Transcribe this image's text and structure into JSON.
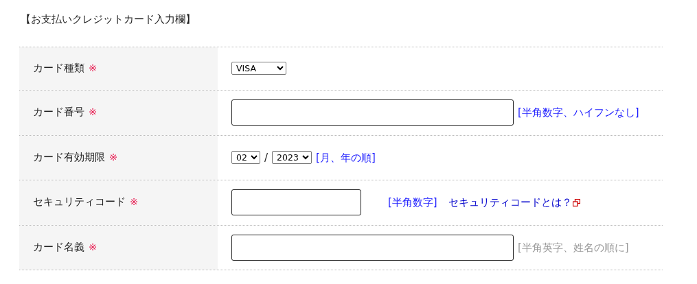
{
  "title": "【お支払いクレジットカード入力欄】",
  "rows": [
    {
      "label": "カード種類",
      "required": true,
      "mark": "※",
      "controls": [
        {
          "kind": "select-wide",
          "value": "VISA"
        }
      ]
    },
    {
      "label": "カード番号",
      "required": true,
      "mark": "※",
      "controls": [
        {
          "kind": "input-long"
        },
        {
          "kind": "hint",
          "text": "[半角数字、ハイフンなし]"
        }
      ]
    },
    {
      "label": "カード有効期限",
      "required": true,
      "mark": "※",
      "controls": [
        {
          "kind": "select",
          "value": "02"
        },
        {
          "kind": "separator",
          "text": "/"
        },
        {
          "kind": "select",
          "value": "2023"
        },
        {
          "kind": "hint",
          "text": "[月、年の順]"
        }
      ]
    },
    {
      "label": "セキュリティコード",
      "required": true,
      "mark": "※",
      "controls": [
        {
          "kind": "input-short"
        },
        {
          "kind": "hint",
          "text": "[半角数字]"
        },
        {
          "kind": "link",
          "text": "セキュリティコードとは？"
        }
      ]
    },
    {
      "label": "カード名義",
      "required": true,
      "mark": "※",
      "controls": [
        {
          "kind": "input-long"
        },
        {
          "kind": "note",
          "text": "[半角英字、姓名の順に]"
        }
      ]
    }
  ]
}
